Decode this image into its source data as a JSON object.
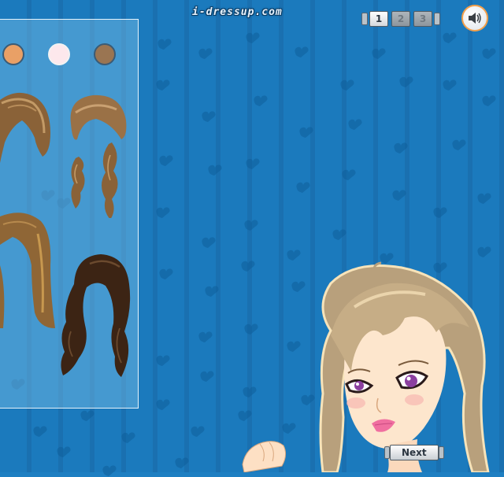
{
  "header": {
    "site_logo": "i-dressup.com"
  },
  "pager": {
    "pages": [
      {
        "label": "1",
        "active": true
      },
      {
        "label": "2",
        "active": false
      },
      {
        "label": "3",
        "active": false
      }
    ]
  },
  "sound": {
    "icon": "speaker-icon"
  },
  "skin_swatches": [
    {
      "color": "#e9a066"
    },
    {
      "color": "#fde8ec"
    },
    {
      "color": "#9a7552"
    }
  ],
  "next_button": {
    "label": "Next"
  },
  "colors": {
    "background": "#1e7fc2",
    "accent": "#f4a04a",
    "hair_light": "#a07a4e",
    "hair_dark": "#3c2414"
  }
}
